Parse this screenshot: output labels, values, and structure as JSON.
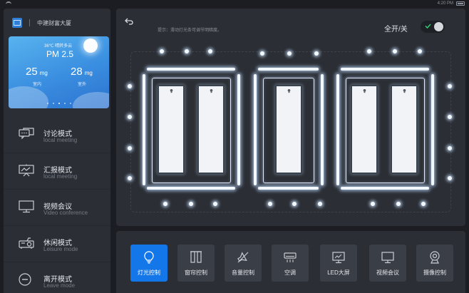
{
  "status": {
    "time": "4:20 PM"
  },
  "brand": {
    "name": "中建财富大厦"
  },
  "weather": {
    "condition": "36℃  晴转多云",
    "pm_title": "PM 2.5",
    "indoor_value": "25",
    "indoor_unit": "mg",
    "indoor_label": "室内",
    "outdoor_value": "28",
    "outdoor_unit": "mg",
    "outdoor_label": "室外"
  },
  "modes": [
    {
      "title": "讨论模式",
      "subtitle": "local meeting",
      "icon": "chat-bubbles-icon"
    },
    {
      "title": "汇报模式",
      "subtitle": "local meeting",
      "icon": "presentation-board-icon"
    },
    {
      "title": "视频会议",
      "subtitle": "Video conference",
      "icon": "monitor-icon"
    },
    {
      "title": "休闲模式",
      "subtitle": "Leisure mode",
      "icon": "projector-icon"
    },
    {
      "title": "离开模式",
      "subtitle": "Leave mode",
      "icon": "leave-circle-icon"
    }
  ],
  "main": {
    "hint": "提示：滑动灯光条可调节明暗度。",
    "all_toggle_label": "全开/关",
    "all_toggle_on": true
  },
  "controls": [
    {
      "label": "灯光控制",
      "icon": "bulb-icon",
      "active": true
    },
    {
      "label": "窗帘控制",
      "icon": "curtain-icon",
      "active": false
    },
    {
      "label": "音量控制",
      "icon": "speaker-icon",
      "active": false
    },
    {
      "label": "空调",
      "icon": "air-conditioner-icon",
      "active": false
    },
    {
      "label": "LED大屏",
      "icon": "led-screen-icon",
      "active": false
    },
    {
      "label": "视频会议",
      "icon": "video-meeting-icon",
      "active": false
    },
    {
      "label": "摄像控制",
      "icon": "camera-icon",
      "active": false
    }
  ],
  "colors": {
    "accent": "#1377ea",
    "panel_bg": "#2b2e35",
    "page_bg": "#1b1d22",
    "toggle_check": "#2ecc71",
    "weather_gradient_start": "#58b3ee",
    "weather_gradient_end": "#2b72cf"
  }
}
